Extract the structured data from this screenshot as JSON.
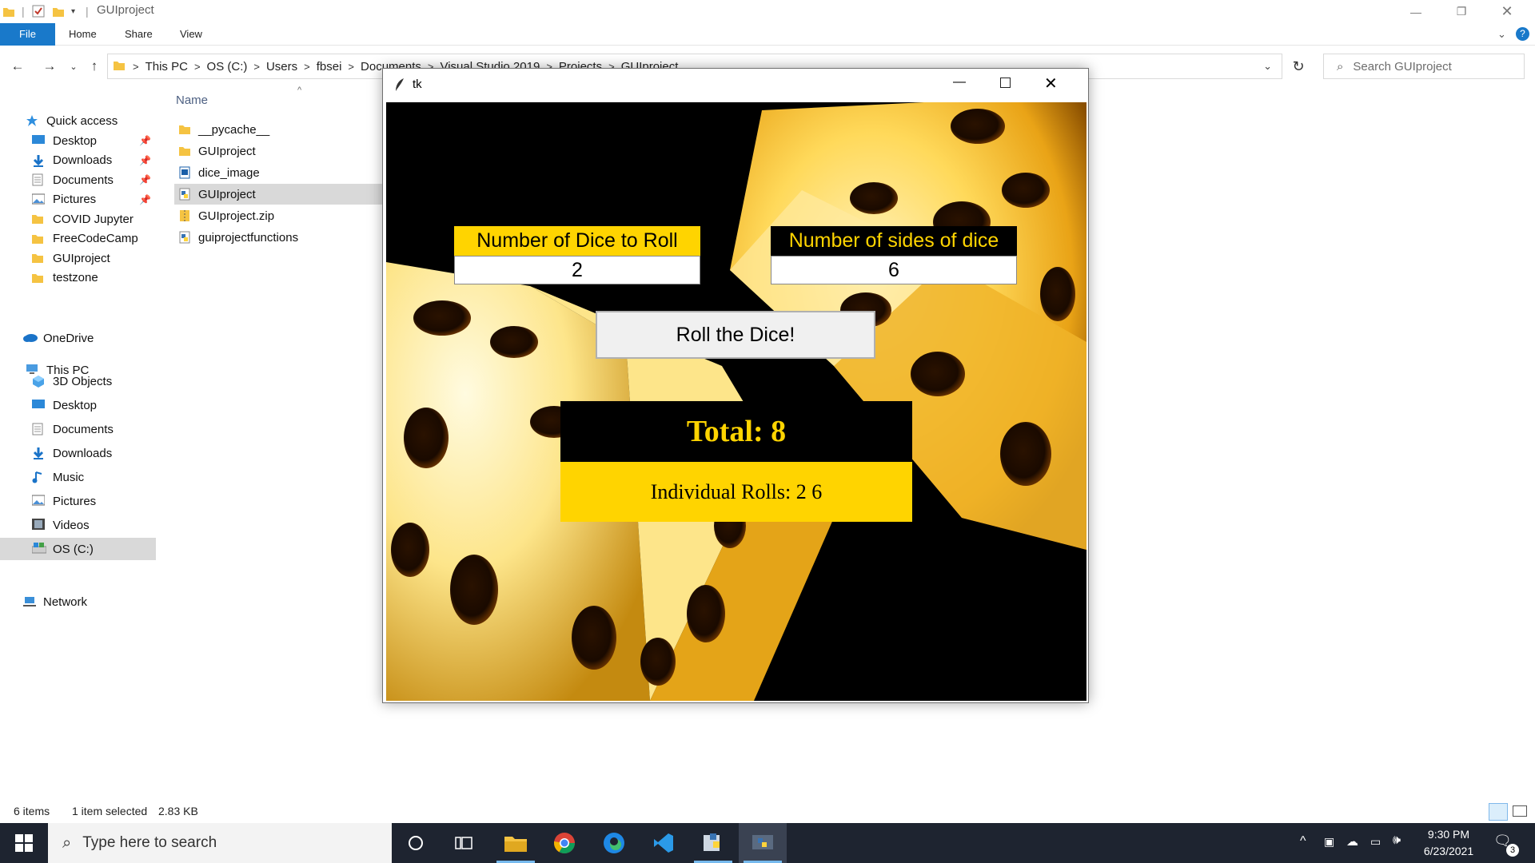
{
  "explorer": {
    "window_title": "GUIproject",
    "tabs": [
      "File",
      "Home",
      "Share",
      "View"
    ],
    "breadcrumb": [
      "This PC",
      "OS (C:)",
      "Users",
      "fbsei",
      "Documents",
      "Visual Studio 2019",
      "Projects",
      "GUIproject"
    ],
    "search_placeholder": "Search GUIproject",
    "column_name": "Name",
    "nav": {
      "quick_access": "Quick access",
      "quick_items": [
        {
          "label": "Desktop",
          "icon": "desktop-icon",
          "pinned": true
        },
        {
          "label": "Downloads",
          "icon": "downloads-icon",
          "pinned": true
        },
        {
          "label": "Documents",
          "icon": "documents-icon",
          "pinned": true
        },
        {
          "label": "Pictures",
          "icon": "pictures-icon",
          "pinned": true
        },
        {
          "label": "COVID Jupyter",
          "icon": "folder-icon",
          "pinned": false
        },
        {
          "label": "FreeCodeCamp",
          "icon": "folder-icon",
          "pinned": false
        },
        {
          "label": "GUIproject",
          "icon": "folder-icon",
          "pinned": false
        },
        {
          "label": "testzone",
          "icon": "folder-icon",
          "pinned": false
        }
      ],
      "onedrive": "OneDrive",
      "this_pc": "This PC",
      "pc_items": [
        {
          "label": "3D Objects",
          "icon": "3d-objects-icon"
        },
        {
          "label": "Desktop",
          "icon": "desktop-icon"
        },
        {
          "label": "Documents",
          "icon": "documents-icon"
        },
        {
          "label": "Downloads",
          "icon": "downloads-icon"
        },
        {
          "label": "Music",
          "icon": "music-icon"
        },
        {
          "label": "Pictures",
          "icon": "pictures-icon"
        },
        {
          "label": "Videos",
          "icon": "videos-icon"
        },
        {
          "label": "OS (C:)",
          "icon": "drive-icon"
        }
      ],
      "network": "Network"
    },
    "files": [
      {
        "name": "__pycache__",
        "icon": "folder-icon",
        "selected": false
      },
      {
        "name": "GUIproject",
        "icon": "folder-icon",
        "selected": false
      },
      {
        "name": "dice_image",
        "icon": "image-file-icon",
        "selected": false
      },
      {
        "name": "GUIproject",
        "icon": "python-file-icon",
        "selected": true
      },
      {
        "name": "GUIproject.zip",
        "icon": "zip-icon",
        "selected": false
      },
      {
        "name": "guiprojectfunctions",
        "icon": "python-file-icon",
        "selected": false
      }
    ],
    "status": {
      "items": "6 items",
      "selected": "1 item selected",
      "size": "2.83 KB"
    }
  },
  "tk": {
    "title": "tk",
    "dice_label": "Number of Dice to Roll",
    "dice_value": "2",
    "sides_label": "Number of sides of dice",
    "sides_value": "6",
    "roll_button": "Roll the Dice!",
    "total": "Total: 8",
    "individual": "Individual Rolls: 2 6",
    "colors": {
      "accent": "#ffd400",
      "dark": "#000000"
    }
  },
  "taskbar": {
    "search_placeholder": "Type here to search",
    "time": "9:30 PM",
    "date": "6/23/2021",
    "notification_count": "3"
  }
}
